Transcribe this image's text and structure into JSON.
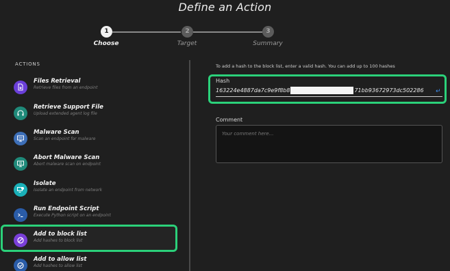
{
  "title": "Define an Action",
  "stepper": {
    "steps": [
      {
        "number": "1",
        "label": "Choose",
        "state": "active"
      },
      {
        "number": "2",
        "label": "Target",
        "state": "inactive"
      },
      {
        "number": "3",
        "label": "Summary",
        "state": "inactive"
      }
    ]
  },
  "actions": {
    "header": "ACTIONS",
    "items": [
      {
        "title": "Files Retrieval",
        "desc": "Retrieve files from an endpoint",
        "icon": "file-retrieval-icon",
        "color": "#6a3fd9"
      },
      {
        "title": "Retrieve Support File",
        "desc": "Upload extended agent log file",
        "icon": "headset-icon",
        "color": "#1f8a7a"
      },
      {
        "title": "Malware Scan",
        "desc": "Scan an endpoint for malware",
        "icon": "monitor-scan-icon",
        "color": "#3d6fb8"
      },
      {
        "title": "Abort Malware Scan",
        "desc": "Abort malware scan on endpoint",
        "icon": "monitor-abort-icon",
        "color": "#1f8a7a"
      },
      {
        "title": "Isolate",
        "desc": "Isolate an endpoint from network",
        "icon": "isolate-icon",
        "color": "#1ab0b8"
      },
      {
        "title": "Run Endpoint Script",
        "desc": "Execute Python script on an endpoint",
        "icon": "terminal-icon",
        "color": "#2a5ca8"
      },
      {
        "title": "Add to block list",
        "desc": "Add hashes to block list",
        "icon": "block-icon",
        "color": "#7a3fd9"
      },
      {
        "title": "Add to allow list",
        "desc": "Add hashes to allow list",
        "icon": "allow-icon",
        "color": "#2a5ca8"
      }
    ]
  },
  "form": {
    "hint": "To add a hash to the block list, enter a valid hash. You can add up to 100 hashes",
    "hash_label": "Hash",
    "hash_start": "163224e4887da7c9e9f8b8",
    "hash_end": "71bb93672973dc502286",
    "comment_label": "Comment",
    "comment_placeholder": "Your comment here..."
  },
  "colors": {
    "highlight": "#2bd17a",
    "background": "#1f1f1f",
    "enter_icon": "#3d8ef0"
  }
}
